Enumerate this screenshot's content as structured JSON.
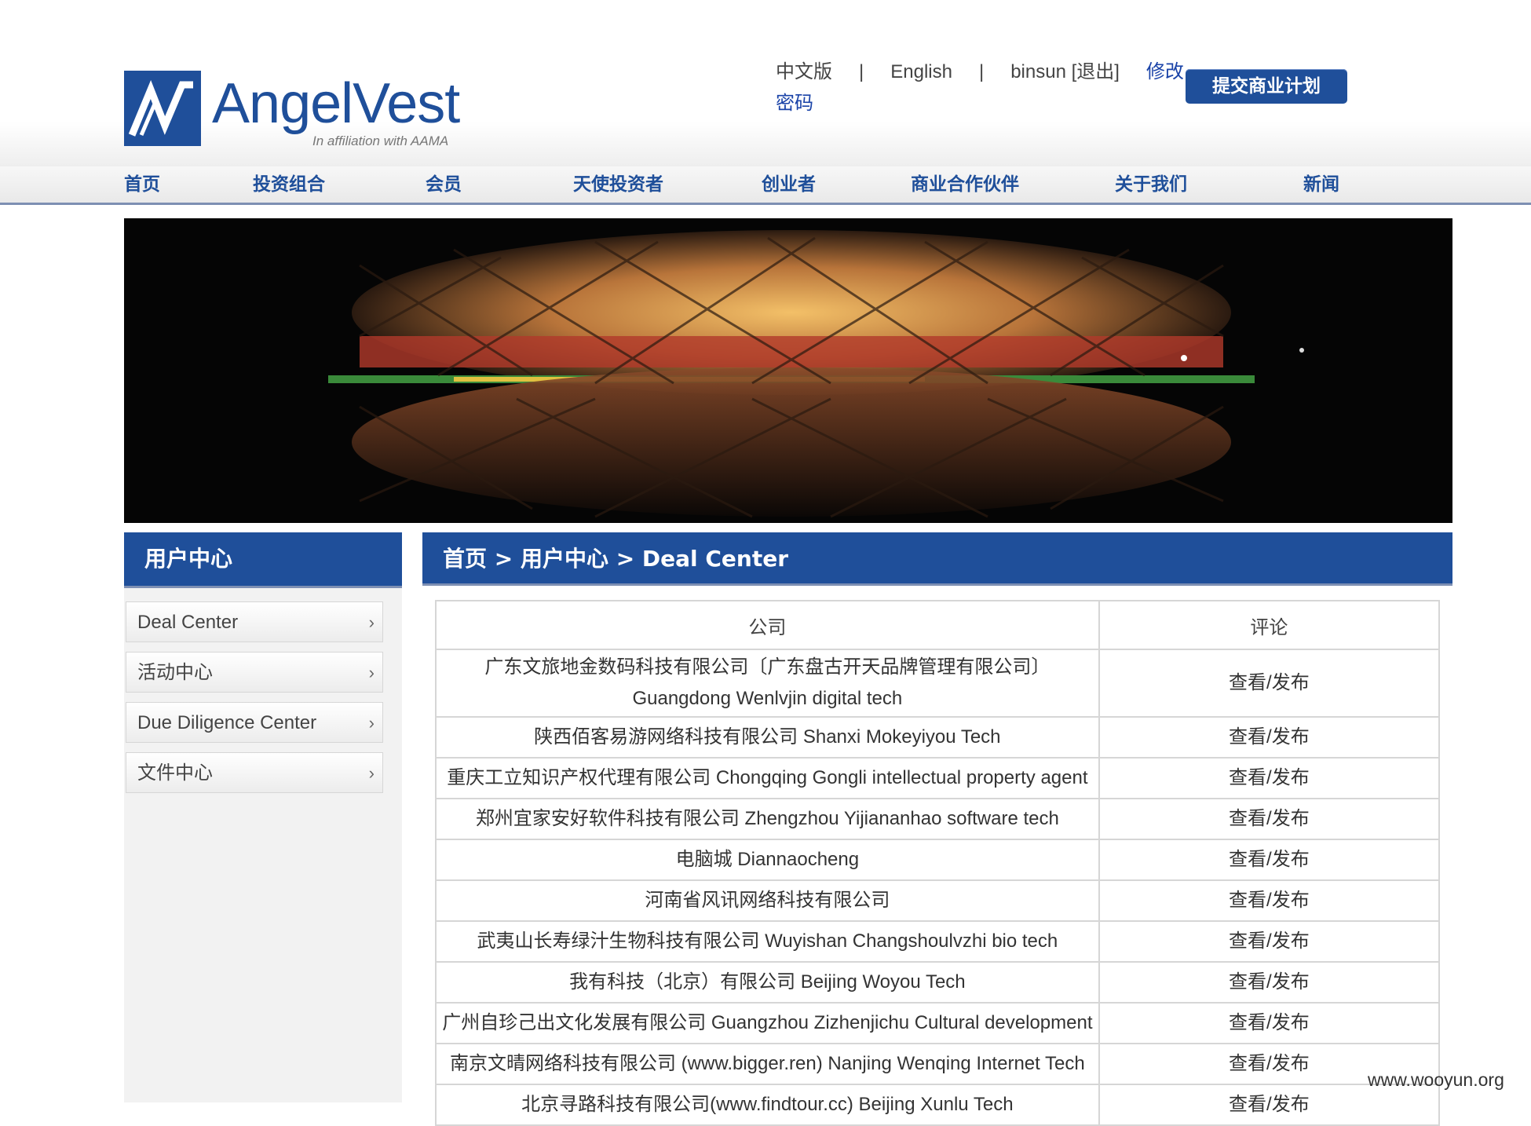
{
  "header": {
    "logo_text": "AngelVest",
    "logo_sub": "In affiliation with AAMA",
    "links": {
      "chinese": "中文版",
      "sep1": "|",
      "english": "English",
      "sep2": "|",
      "user": "binsun [退出]",
      "change_password": "修改密码"
    },
    "submit_plan": "提交商业计划"
  },
  "nav": [
    "首页",
    "投资组合",
    "会员",
    "天使投资者",
    "创业者",
    "商业合作伙伴",
    "关于我们",
    "新闻"
  ],
  "sidebar": {
    "title": "用户中心",
    "items": [
      "Deal Center",
      "活动中心",
      "Due Diligence Center",
      "文件中心"
    ]
  },
  "breadcrumb": "首页 > 用户中心 > Deal Center",
  "table": {
    "headers": [
      "公司",
      "评论"
    ],
    "rows": [
      {
        "company": "广东文旅地金数码科技有限公司〔广东盘古开天品牌管理有限公司〕",
        "company2": "Guangdong Wenlvjin digital tech",
        "comment": "查看/发布"
      },
      {
        "company": "陕西佰客易游网络科技有限公司 Shanxi Mokeyiyou Tech",
        "company2": "",
        "comment": "查看/发布"
      },
      {
        "company": "重庆工立知识产权代理有限公司 Chongqing Gongli intellectual property agent",
        "company2": "",
        "comment": "查看/发布"
      },
      {
        "company": "郑州宜家安好软件科技有限公司 Zhengzhou Yijiananhao software tech",
        "company2": "",
        "comment": "查看/发布"
      },
      {
        "company": "电脑城 Diannaocheng",
        "company2": "",
        "comment": "查看/发布"
      },
      {
        "company": "河南省风讯网络科技有限公司",
        "company2": "",
        "comment": "查看/发布"
      },
      {
        "company": "武夷山长寿绿汁生物科技有限公司 Wuyishan Changshoulvzhi bio tech",
        "company2": "",
        "comment": "查看/发布"
      },
      {
        "company": "我有科技（北京）有限公司 Beijing Woyou Tech",
        "company2": "",
        "comment": "查看/发布"
      },
      {
        "company": "广州自珍己出文化发展有限公司 Guangzhou Zizhenjichu Cultural development",
        "company2": "",
        "comment": "查看/发布"
      },
      {
        "company": "南京文晴网络科技有限公司 (www.bigger.ren) Nanjing Wenqing Internet Tech",
        "company2": "",
        "comment": "查看/发布"
      },
      {
        "company": "北京寻路科技有限公司(www.findtour.cc) Beijing Xunlu Tech",
        "company2": "",
        "comment": "查看/发布"
      }
    ]
  },
  "watermark": "www.wooyun.org",
  "colors": {
    "brand": "#1f4f9a",
    "link": "#1a43a8",
    "border": "#d6d6d6"
  }
}
